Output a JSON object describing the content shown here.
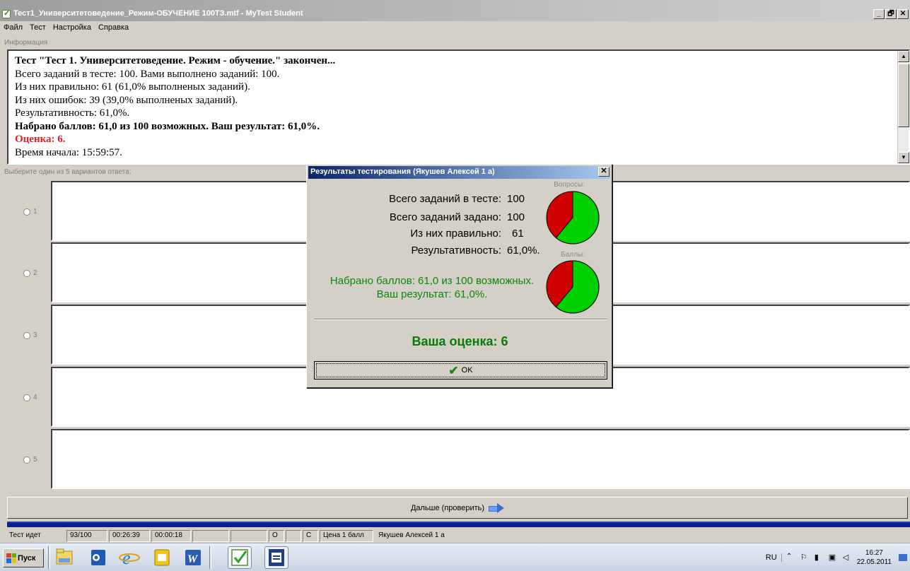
{
  "window": {
    "title": "Тест1_Университетоведение_Режим-ОБУЧЕНИЕ 100ТЗ.mtf - MyTest Student",
    "controls": [
      "_",
      "🗗",
      "✕"
    ]
  },
  "menu": [
    "Файл",
    "Тест",
    "Настройка",
    "Справка"
  ],
  "info_label": "Информация",
  "info": {
    "line1": "Тест \"Тест 1. Университетоведение. Режим - обучение.\" закончен...",
    "line2": "Всего заданий в тесте: 100. Вами выполнено заданий: 100.",
    "line3": "Из них правильно: 61 (61,0% выполненых заданий).",
    "line4": "Из них ошибок: 39 (39,0% выполненых заданий).",
    "line5": "Результативность: 61,0%.",
    "line6": "Набрано баллов: 61,0 из 100 возможных. Ваш результат: 61,0%.",
    "line7": "Оценка: 6.",
    "line8": "Время начала: 15:59:57."
  },
  "answers_label": "Выберите один из 5 вариантов ответа:",
  "answers": [
    {
      "num": "1"
    },
    {
      "num": "2"
    },
    {
      "num": "3"
    },
    {
      "num": "4"
    },
    {
      "num": "5"
    }
  ],
  "next_button": "Дальше (проверить)",
  "status": {
    "state": "Тест идет",
    "progress": "93/100",
    "elapsed": "00:26:39",
    "question_time": "00:00:18",
    "o": "О",
    "c": "С",
    "price": "Цена 1 балл",
    "user": "Якушев Алексей 1 а"
  },
  "dialog": {
    "title": "Результаты тестирования (Якушев Алексей 1 а)",
    "close": "✕",
    "rows": [
      {
        "label": "Всего заданий в тесте:",
        "value": "100"
      },
      {
        "label": "Всего заданий задано:",
        "value": "100"
      },
      {
        "label": "Из них правильно:",
        "value": "61"
      },
      {
        "label": "Результативность:",
        "value": "61,0%."
      }
    ],
    "pie1_caption": "Вопросы:",
    "pie2_caption": "Баллы:",
    "pie1_correct_fraction": 0.61,
    "pie2_correct_fraction": 0.61,
    "colors": {
      "correct": "#00d000",
      "wrong": "#d00000",
      "score_text": "#0a8a0a"
    },
    "score_line1": "Набрано баллов: 61,0 из 100 возможных.",
    "score_line2": "Ваш результат: 61,0%.",
    "grade": "Ваша оценка: 6",
    "ok": "OK"
  },
  "taskbar": {
    "start": "Пуск",
    "apps": [
      "file-explorer-icon",
      "outlook-icon",
      "internet-explorer-icon",
      "outlook-calendar-icon",
      "word-icon",
      "mytest-icon",
      "document-icon"
    ],
    "lang": "RU",
    "time": "16:27",
    "date": "22.05.2011"
  }
}
